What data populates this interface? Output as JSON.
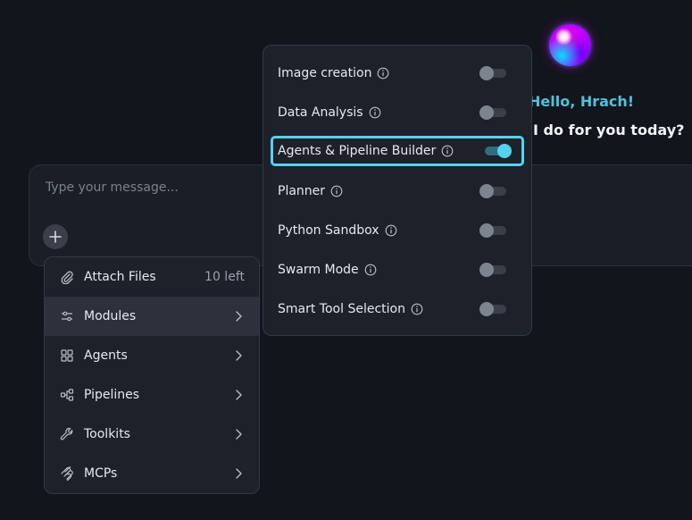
{
  "greeting": "Hello, Hrach!",
  "question": "n I do for you today?",
  "composer": {
    "placeholder": "Type your message..."
  },
  "menu": {
    "items": [
      {
        "label": "Attach Files",
        "right": "10 left",
        "icon": "paperclip-icon"
      },
      {
        "label": "Modules",
        "icon": "sliders-icon"
      },
      {
        "label": "Agents",
        "icon": "grid-icon"
      },
      {
        "label": "Pipelines",
        "icon": "pipeline-icon"
      },
      {
        "label": "Toolkits",
        "icon": "wrench-icon"
      },
      {
        "label": "MCPs",
        "icon": "mcp-icon"
      }
    ]
  },
  "modules": {
    "items": [
      {
        "label": "Image creation",
        "enabled": false
      },
      {
        "label": "Data Analysis",
        "enabled": false
      },
      {
        "label": "Agents & Pipeline Builder",
        "enabled": true
      },
      {
        "label": "Planner",
        "enabled": false
      },
      {
        "label": "Python Sandbox",
        "enabled": false
      },
      {
        "label": "Swarm Mode",
        "enabled": false
      },
      {
        "label": "Smart Tool Selection",
        "enabled": false
      }
    ]
  },
  "colors": {
    "accent": "#54d2ee",
    "greeting": "#4fc3d9",
    "background": "#12151c"
  }
}
